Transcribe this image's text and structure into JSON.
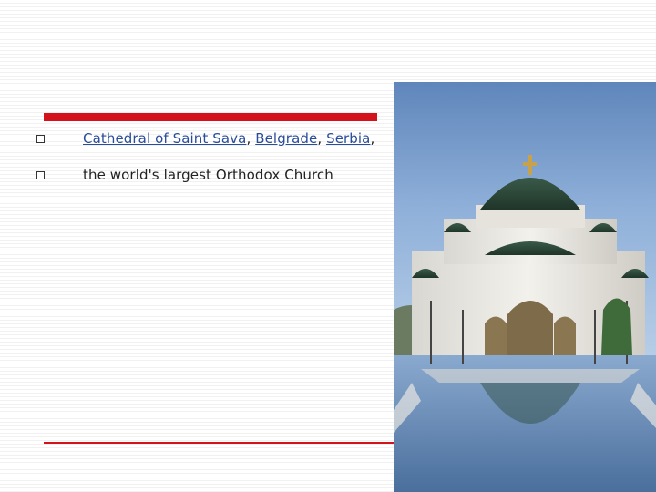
{
  "slide": {
    "bullets": [
      {
        "parts": [
          {
            "text": "Cathedral of Saint Sava",
            "link": true
          },
          {
            "text": ", ",
            "link": false
          },
          {
            "text": "Belgrade",
            "link": true
          },
          {
            "text": ", ",
            "link": false
          },
          {
            "text": "Serbia",
            "link": true
          },
          {
            "text": ",",
            "link": false
          }
        ]
      },
      {
        "parts": [
          {
            "text": "the world's largest Orthodox Church",
            "link": false
          }
        ]
      }
    ],
    "colors": {
      "accent_red": "#d4121c",
      "link_blue": "#2a4d9b"
    },
    "image": {
      "subject": "cathedral-photo"
    }
  }
}
